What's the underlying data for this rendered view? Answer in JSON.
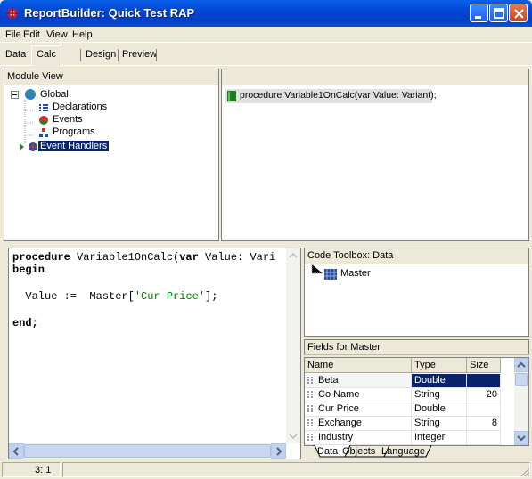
{
  "window": {
    "title": "ReportBuilder: Quick Test RAP"
  },
  "menu": [
    "File",
    "Edit",
    "View",
    "Help"
  ],
  "tabs": {
    "data": "Data",
    "calc": "Calc",
    "design": "Design",
    "preview": "Preview"
  },
  "module_view": {
    "header": "Module View",
    "global": "Global",
    "declarations": "Declarations",
    "events": "Events",
    "programs": "Programs",
    "event_handlers": "Event Handlers"
  },
  "procedure_list": {
    "item": "procedure Variable1OnCalc(var Value: Variant);"
  },
  "code": {
    "kw_procedure": "procedure",
    "sig1": " Variable1OnCalc(",
    "kw_var": "var",
    "sig2": " Value: Vari",
    "begin": "begin",
    "assign": "  Value :=  Master[",
    "string": "'Cur Price'",
    "close": "];",
    "end": "end;"
  },
  "toolbox": {
    "header": "Code Toolbox: Data",
    "item": "Master"
  },
  "fields": {
    "header": "Fields for Master",
    "columns": {
      "name": "Name",
      "type": "Type",
      "size": "Size"
    },
    "rows": [
      {
        "name": "Beta",
        "type": "Double",
        "size": ""
      },
      {
        "name": "Co Name",
        "type": "String",
        "size": "20"
      },
      {
        "name": "Cur Price",
        "type": "Double",
        "size": ""
      },
      {
        "name": "Exchange",
        "type": "String",
        "size": "8"
      },
      {
        "name": "Industry",
        "type": "Integer",
        "size": ""
      }
    ]
  },
  "bottom_tabs": {
    "data": "Data",
    "objects": "Objects",
    "language": "Language"
  },
  "status": {
    "position": "3: 1"
  }
}
